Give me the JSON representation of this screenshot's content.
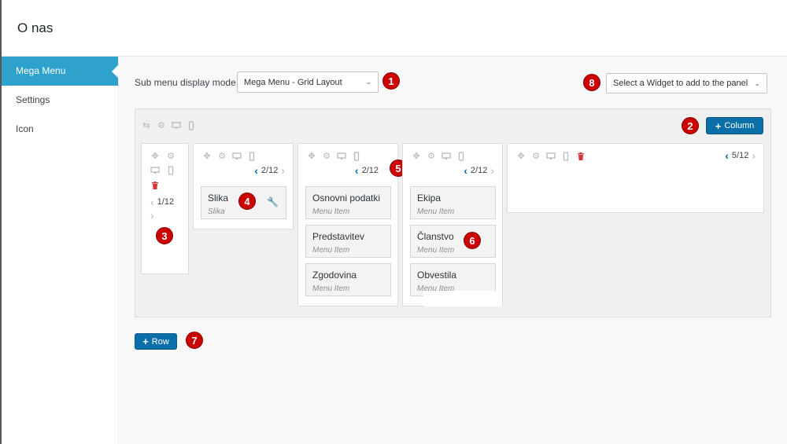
{
  "page": {
    "title": "O nas"
  },
  "sidebar": {
    "items": [
      {
        "label": "Mega Menu",
        "active": true
      },
      {
        "label": "Settings",
        "active": false
      },
      {
        "label": "Icon",
        "active": false
      }
    ]
  },
  "controls": {
    "submenu_label": "Sub menu display mode",
    "submenu_value": "Mega Menu - Grid Layout",
    "widget_select_value": "Select a Widget to add to the panel"
  },
  "buttons": {
    "add_column": "Column",
    "add_row": "Row"
  },
  "columns": [
    {
      "span": "1/12"
    },
    {
      "span": "2/12",
      "items": [
        {
          "title": "Slika",
          "sub": "Slika"
        }
      ]
    },
    {
      "span": "2/12",
      "items": [
        {
          "title": "Osnovni podatki",
          "sub": "Menu Item"
        },
        {
          "title": "Predstavitev",
          "sub": "Menu Item"
        },
        {
          "title": "Zgodovina",
          "sub": "Menu Item"
        }
      ]
    },
    {
      "span": "2/12",
      "items": [
        {
          "title": "Ekipa",
          "sub": "Menu Item"
        },
        {
          "title": "Članstvo",
          "sub": "Menu Item"
        },
        {
          "title": "Obvestila",
          "sub": "Menu Item"
        }
      ]
    },
    {
      "span": "5/12"
    }
  ],
  "badges": [
    "1",
    "2",
    "3",
    "4",
    "5",
    "6",
    "7",
    "8"
  ],
  "colors": {
    "accent": "#2ea2cc",
    "button": "#0a6ea8",
    "badge": "#cc0000",
    "danger": "#d63638"
  }
}
